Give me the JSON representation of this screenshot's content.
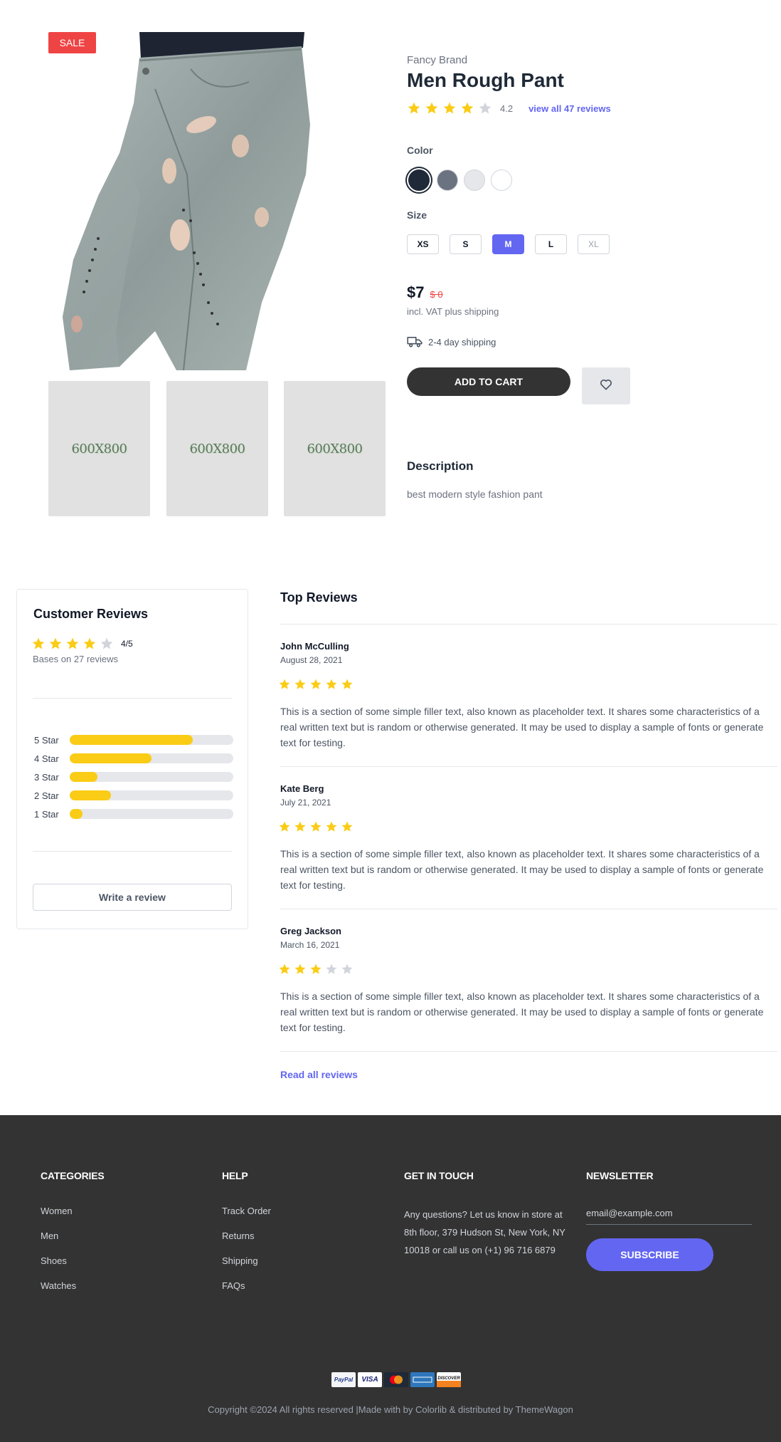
{
  "product": {
    "sale_badge": "SALE",
    "brand": "Fancy Brand",
    "title": "Men Rough Pant",
    "rating_value": 4,
    "rating_text": "4.2",
    "reviews_link": "view all 47 reviews",
    "color_label": "Color",
    "colors": [
      {
        "name": "dark-navy",
        "hex": "#1f2937",
        "selected": true
      },
      {
        "name": "gray",
        "hex": "#6b7280",
        "selected": false
      },
      {
        "name": "light-gray",
        "hex": "#e5e7eb",
        "selected": false
      },
      {
        "name": "white",
        "hex": "#ffffff",
        "selected": false
      }
    ],
    "size_label": "Size",
    "sizes": [
      {
        "label": "XS",
        "state": "available"
      },
      {
        "label": "S",
        "state": "available"
      },
      {
        "label": "M",
        "state": "selected"
      },
      {
        "label": "L",
        "state": "available"
      },
      {
        "label": "XL",
        "state": "disabled"
      }
    ],
    "price": "$7",
    "old_price": "$ 0",
    "vat_note": "incl. VAT plus shipping",
    "shipping_note": "2-4 day shipping",
    "add_to_cart": "ADD TO CART",
    "thumbnails": [
      "600X800",
      "600X800",
      "600X800"
    ],
    "description_title": "Description",
    "description_text": "best modern style fashion pant"
  },
  "customer_reviews": {
    "title": "Customer Reviews",
    "rating_value": 4,
    "score": "4/5",
    "based_on": "Bases on 27 reviews",
    "breakdown": [
      {
        "label": "5 Star",
        "fraction": 0.75
      },
      {
        "label": "4 Star",
        "fraction": 0.5
      },
      {
        "label": "3 Star",
        "fraction": 0.17
      },
      {
        "label": "2 Star",
        "fraction": 0.25
      },
      {
        "label": "1 Star",
        "fraction": 0.08
      }
    ],
    "write_review": "Write a review"
  },
  "top_reviews": {
    "title": "Top Reviews",
    "items": [
      {
        "name": "John McCulling",
        "date": "August 28, 2021",
        "stars": 5,
        "text": "This is a section of some simple filler text, also known as placeholder text. It shares some characteristics of a real written text but is random or otherwise generated. It may be used to display a sample of fonts or generate text for testing."
      },
      {
        "name": "Kate Berg",
        "date": "July 21, 2021",
        "stars": 5,
        "text": "This is a section of some simple filler text, also known as placeholder text. It shares some characteristics of a real written text but is random or otherwise generated. It may be used to display a sample of fonts or generate text for testing."
      },
      {
        "name": "Greg Jackson",
        "date": "March 16, 2021",
        "stars": 3,
        "text": "This is a section of some simple filler text, also known as placeholder text. It shares some characteristics of a real written text but is random or otherwise generated. It may be used to display a sample of fonts or generate text for testing."
      }
    ],
    "read_all": "Read all reviews"
  },
  "footer": {
    "categories": {
      "title": "CATEGORIES",
      "links": [
        "Women",
        "Men",
        "Shoes",
        "Watches"
      ]
    },
    "help": {
      "title": "HELP",
      "links": [
        "Track Order",
        "Returns",
        "Shipping",
        "FAQs"
      ]
    },
    "contact": {
      "title": "GET IN TOUCH",
      "text": "Any questions? Let us know in store at 8th floor, 379 Hudson St, New York, NY 10018 or call us on (+1) 96 716 6879"
    },
    "newsletter": {
      "title": "NEWSLETTER",
      "placeholder": "email@example.com",
      "button": "SUBSCRIBE"
    },
    "payments": [
      "PayPal",
      "VISA",
      "MasterCard",
      "AmEx",
      "Discover"
    ],
    "copyright": "Copyright ©2024 All rights reserved |Made with      by Colorlib & distributed by ThemeWagon"
  },
  "colors": {
    "accent": "#6366f1",
    "star": "#facc15",
    "star_empty": "#d1d5db",
    "sale": "#ef4444",
    "footer_bg": "#333333"
  }
}
